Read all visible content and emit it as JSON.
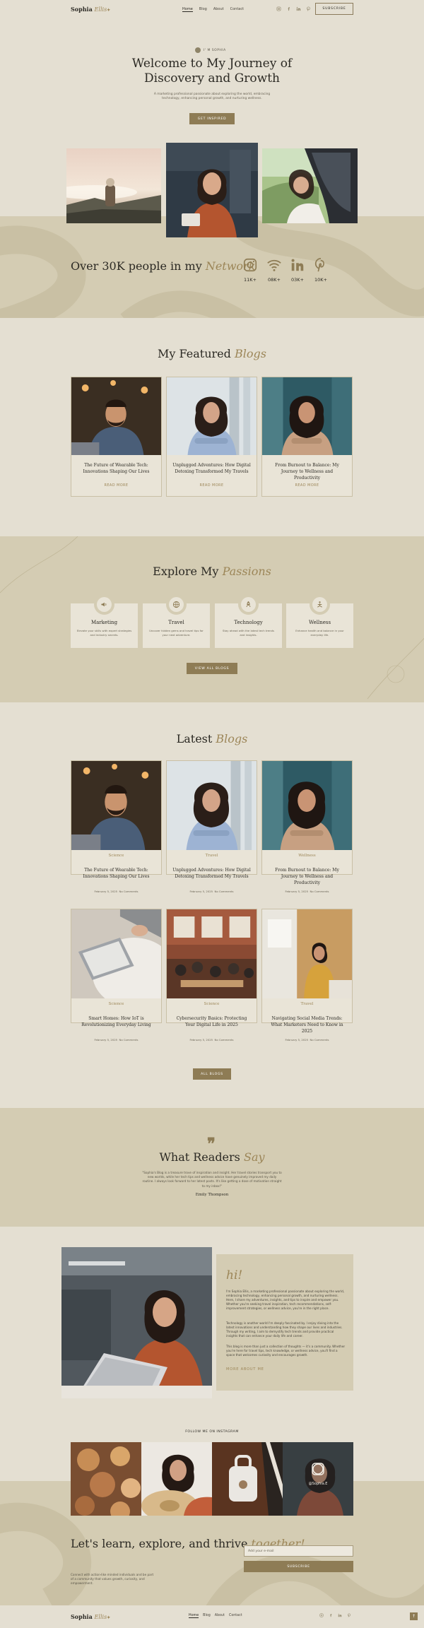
{
  "header": {
    "logo_first": "Sophia",
    "logo_second": "Ellis",
    "nav": [
      "Home",
      "Blog",
      "About",
      "Contact"
    ],
    "subscribe_label": "SUBSCRIBE"
  },
  "hero": {
    "pill": "I' M SOPHIA",
    "title": "Welcome to My Journey of Discovery and Growth",
    "subtitle": "A marketing professional passionate about exploring the world, embracing technology, enhancing personal growth, and nurturing wellness.",
    "cta": "GET INSPIRED"
  },
  "stats": {
    "title_lead": "Over 30K people in my",
    "title_accent": "Network",
    "items": [
      {
        "icon": "instagram-icon",
        "value": "11K+"
      },
      {
        "icon": "wifi-icon",
        "value": "08K+"
      },
      {
        "icon": "linkedin-icon",
        "value": "03K+"
      },
      {
        "icon": "pinterest-icon",
        "value": "10K+"
      }
    ]
  },
  "featured": {
    "title_lead": "My Featured",
    "title_accent": "Blogs",
    "posts": [
      {
        "title": "The Future of Wearable Tech: Innovations Shaping Our Lives",
        "more": "READ MORE"
      },
      {
        "title": "Unplugged Adventures: How Digital Detoxing Transformed My Travels",
        "more": "READ MORE"
      },
      {
        "title": "From Burnout to Balance: My Journey to Wellness and Productivity",
        "more": "READ MORE"
      }
    ]
  },
  "passions": {
    "title_lead": "Explore My",
    "title_accent": "Passions",
    "items": [
      {
        "name": "Marketing",
        "desc": "Elevate your skills with expert strategies and industry secrets."
      },
      {
        "name": "Travel",
        "desc": "Uncover hidden gems and travel tips for your next adventure."
      },
      {
        "name": "Technology",
        "desc": "Stay ahead with the latest tech trends and insights."
      },
      {
        "name": "Wellness",
        "desc": "Enhance health and balance in your everyday life."
      }
    ],
    "cta": "VIEW ALL BLOGS"
  },
  "latest": {
    "title_lead": "Latest",
    "title_accent": "Blogs",
    "posts": [
      {
        "category": "Science",
        "title": "The Future of Wearable Tech: Innovations Shaping Our Lives",
        "date": "February 5, 2025",
        "comments": "No Comments"
      },
      {
        "category": "Travel",
        "title": "Unplugged Adventures: How Digital Detoxing Transformed My Travels",
        "date": "February 5, 2025",
        "comments": "No Comments"
      },
      {
        "category": "Wellness",
        "title": "From Burnout to Balance: My Journey to Wellness and Productivity",
        "date": "February 5, 2025",
        "comments": "No Comments"
      },
      {
        "category": "Science",
        "title": "Smart Homes: How IoT is Revolutionizing Everyday Living",
        "date": "February 5, 2025",
        "comments": "No Comments"
      },
      {
        "category": "Science",
        "title": "Cybersecurity Basics: Protecting Your Digital Life in 2025",
        "date": "February 5, 2025",
        "comments": "No Comments"
      },
      {
        "category": "Travel",
        "title": "Navigating Social Media Trends: What Marketers Need to Know in 2025",
        "date": "February 5, 2025",
        "comments": "No Comments"
      }
    ],
    "cta": "ALL BLOGS"
  },
  "testimonial": {
    "title_lead": "What Readers",
    "title_accent": "Say",
    "quote": "\"Sophia's Blog is a treasure trove of inspiration and insight. Her travel stories transport you to new worlds, while her tech tips and wellness advice have genuinely improved my daily routine. I always look forward to her latest posts. It's like getting a dose of motivation straight to my inbox!\"",
    "author": "Emily Thompson"
  },
  "about": {
    "hi": "hi!",
    "p1": "I'm Sophia Ellis, a marketing professional passionate about exploring the world, embracing technology, enhancing personal growth, and nurturing wellness. Here, I share my adventures, insights, and tips to inspire and empower you. Whether you're seeking travel inspiration, tech recommendations, self-improvement strategies, or wellness advice, you're in the right place.",
    "p2": "Technology is another world I'm deeply fascinated by. I enjoy diving into the latest innovations and understanding how they shape our lives and industries. Through my writing, I aim to demystify tech trends and provide practical insights that can enhance your daily life and career.",
    "p3": "This blog is more than just a collection of thoughts — it's a community. Whether you're here for travel tips, tech knowledge, or wellness advice, you'll find a space that welcomes curiosity and encourages growth.",
    "more": "MORE ABOUT ME"
  },
  "instagram": {
    "title": "FOLLOW ME ON INSTAGRAM",
    "overlay_handle": "@Sophia.E"
  },
  "newsletter": {
    "title_lead": "Let's learn, explore, and thrive",
    "title_accent": "together!",
    "subtitle": "Connect with action-like minded individuals and be part of a community that values growth, curiosity, and empowerment.",
    "email_placeholder": "Add your e-mail",
    "button": "SUBSCRIBE"
  },
  "footer": {
    "nav": [
      "Home",
      "Blog",
      "About",
      "Contact"
    ],
    "to_top": "↑"
  }
}
